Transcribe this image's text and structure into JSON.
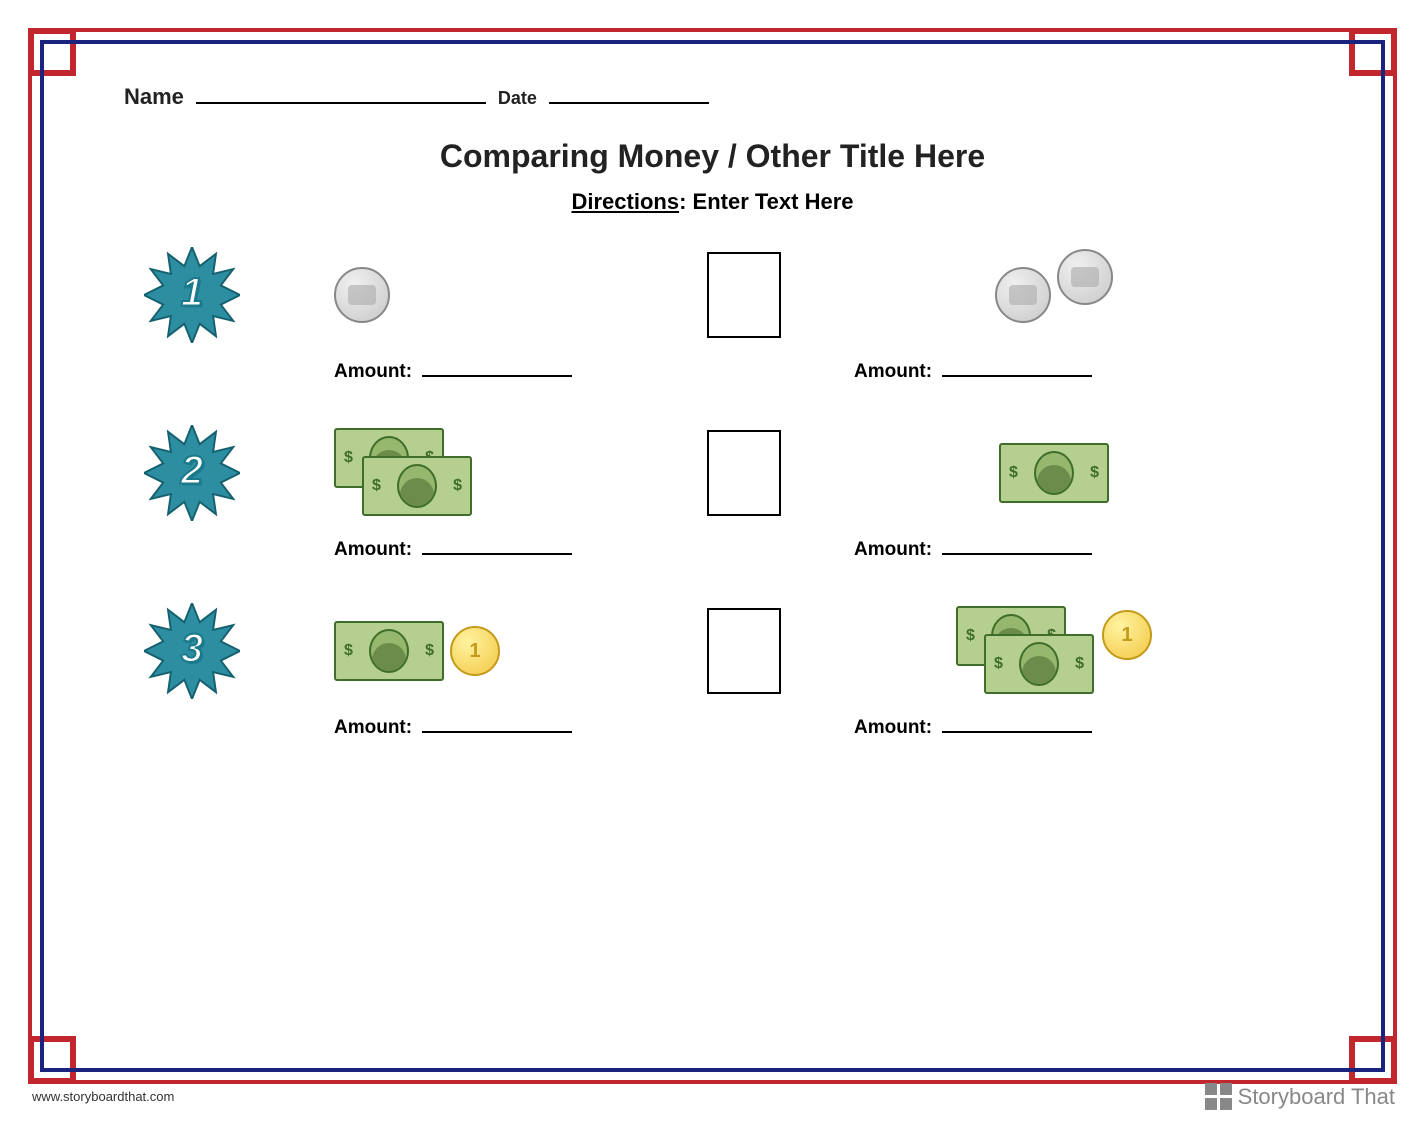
{
  "header": {
    "name_label": "Name",
    "date_label": "Date"
  },
  "title": "Comparing Money / Other Title Here",
  "directions": {
    "label": "Directions",
    "text": ": Enter Text Here"
  },
  "amount_label": "Amount:",
  "rows": [
    {
      "number": "1",
      "left_money": {
        "silver_coins": 1,
        "gold_coins": 0,
        "bills": 0
      },
      "right_money": {
        "silver_coins": 2,
        "gold_coins": 0,
        "bills": 0
      }
    },
    {
      "number": "2",
      "left_money": {
        "silver_coins": 0,
        "gold_coins": 0,
        "bills": 2
      },
      "right_money": {
        "silver_coins": 0,
        "gold_coins": 0,
        "bills": 1
      }
    },
    {
      "number": "3",
      "left_money": {
        "silver_coins": 0,
        "gold_coins": 1,
        "bills": 1
      },
      "right_money": {
        "silver_coins": 0,
        "gold_coins": 1,
        "bills": 2
      }
    }
  ],
  "coin_gold_label": "1",
  "bill_symbol": "$",
  "footer": {
    "url": "www.storyboardthat.com",
    "brand": "Storyboard That"
  }
}
